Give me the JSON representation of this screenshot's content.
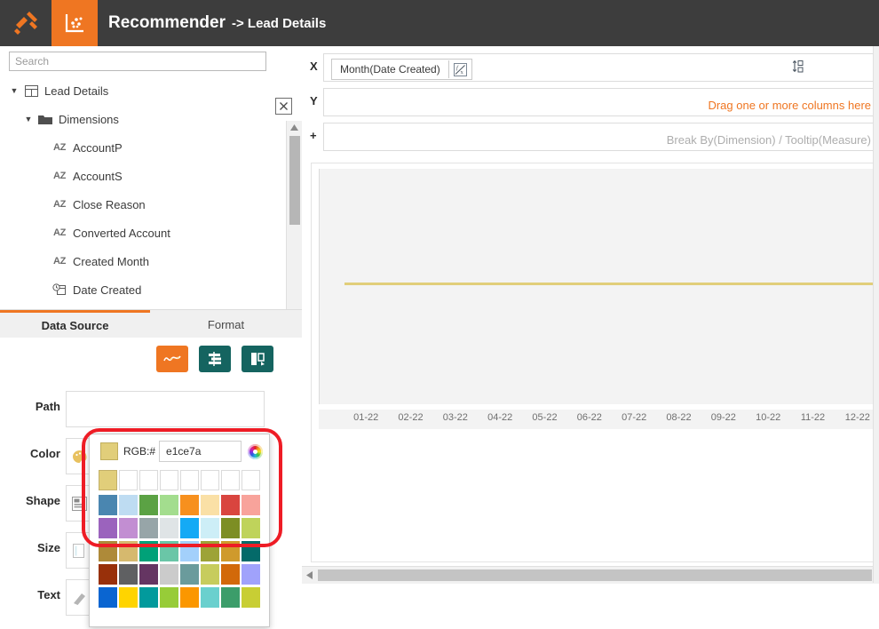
{
  "header": {
    "logo_icon": "tools-logo-icon",
    "tab_icon": "scatter-chart-icon",
    "app_title": "Recommender",
    "breadcrumb_separator_and_page": "-> Lead Details"
  },
  "sidebar": {
    "search": {
      "value": "",
      "placeholder": "Search"
    },
    "clear_icon": "close-box-icon",
    "tree": [
      {
        "label": "Lead Details",
        "level": 1,
        "icon": "table-icon",
        "expanded": true,
        "caret": "▼"
      },
      {
        "label": "Dimensions",
        "level": 2,
        "icon": "folder-icon",
        "expanded": true,
        "caret": "▼"
      },
      {
        "label": "AccountP",
        "level": 3,
        "icon": "az-icon"
      },
      {
        "label": "AccountS",
        "level": 3,
        "icon": "az-icon"
      },
      {
        "label": "Close Reason",
        "level": 3,
        "icon": "az-icon"
      },
      {
        "label": "Converted Account",
        "level": 3,
        "icon": "az-icon"
      },
      {
        "label": "Created Month",
        "level": 3,
        "icon": "az-icon"
      },
      {
        "label": "Date Created",
        "level": 3,
        "icon": "calendar-clock-icon"
      }
    ],
    "scroll_up_icon": "scroll-up-arrow-icon",
    "scroll_down_icon": "scroll-down-arrow-icon",
    "tabs": [
      {
        "label": "Data Source",
        "active": true
      },
      {
        "label": "Format",
        "active": false
      }
    ],
    "mark_buttons": [
      {
        "icon": "line-chart-icon",
        "color": "#ef7622",
        "active": true
      },
      {
        "icon": "align-icon",
        "color": "#156460",
        "active": false
      },
      {
        "icon": "flip-icon",
        "color": "#156460",
        "active": false
      }
    ],
    "mark_rows": [
      {
        "label": "Path",
        "icon": ""
      },
      {
        "label": "Color",
        "icon": "palette-icon"
      },
      {
        "label": "Shape",
        "icon": "list-shape-icon"
      },
      {
        "label": "Size",
        "icon": "size-icon"
      },
      {
        "label": "Text",
        "icon": "text-icon"
      }
    ]
  },
  "color_picker": {
    "current_color": "#e1ce7a",
    "rgb_label": "RGB:#",
    "rgb_value": "e1ce7a",
    "rgb_placeholder": "e1ce7a",
    "wheel_icon": "color-wheel-icon",
    "recent_colors": [
      "#e1ce7a",
      "",
      "",
      "",
      "",
      "",
      "",
      ""
    ],
    "palette": [
      [
        "#4a86b0",
        "#bedcf2",
        "#5ba244",
        "#a3dd8e",
        "#f7901e",
        "#fae0a6",
        "#d9453f",
        "#f8a39b"
      ],
      [
        "#9b63bd",
        "#c28ed2",
        "#97a5a8",
        "#dfe4e6",
        "#14aaf5",
        "#cdeef7",
        "#7d8e24",
        "#bfd35b"
      ],
      [
        "#ae8a39",
        "#d6b96e",
        "#00a178",
        "#6ac6a7",
        "#a3d0fb",
        "#9da337",
        "#cf9a2c",
        "#046a69"
      ],
      [
        "#98300a",
        "#5f6062",
        "#653562",
        "#cbcbcb",
        "#6a9b9c",
        "#c7cc5d",
        "#d2690a",
        "#a0a2fb"
      ],
      [
        "#0a65d1",
        "#ffd400",
        "#029a9c",
        "#97cc38",
        "#fb9700",
        "#6ad0ce",
        "#3c9d6a",
        "#c8ce34"
      ]
    ]
  },
  "shelves": [
    {
      "key": "X",
      "pill": "Month(Date Created)",
      "fx_icon": "formula-icon",
      "sort_icon": "sort-icon",
      "hint": ""
    },
    {
      "key": "Y",
      "pill": "",
      "hint": "Drag one or more columns here",
      "hint_style": "orange"
    },
    {
      "key": "+",
      "pill": "",
      "hint": "Break By(Dimension) / Tooltip(Measure)",
      "hint_style": "gray"
    }
  ],
  "chart_data": {
    "type": "line",
    "title": "",
    "xlabel": "",
    "ylabel": "",
    "categories": [
      "01-22",
      "02-22",
      "03-22",
      "04-22",
      "05-22",
      "06-22",
      "07-22",
      "08-22",
      "09-22",
      "10-22",
      "11-22",
      "12-22"
    ],
    "series": [
      {
        "name": "Month(Date Created)",
        "color": "#e1ce7a",
        "values": [
          0,
          0,
          0,
          0,
          0,
          0,
          0,
          0,
          0,
          0,
          0,
          0
        ]
      }
    ],
    "grid": false,
    "legend": "none",
    "plot_background": "#f3f3f3"
  },
  "scrollbars": {
    "h_left_arrow_icon": "scroll-left-arrow-icon"
  }
}
